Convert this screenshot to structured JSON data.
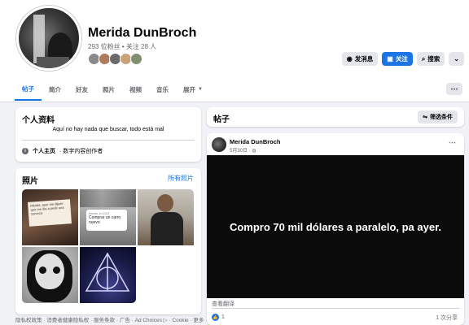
{
  "profile": {
    "name": "Merida DunBroch",
    "followers_line": "293 位粉丝 • 关注 28 人",
    "friend_colors": [
      "#8a8a8a",
      "#b07a5a",
      "#6a6a6a",
      "#c9a27a",
      "#7f8f6f"
    ]
  },
  "header_buttons": {
    "message": "发消息",
    "follow": "关注",
    "search": "搜索"
  },
  "tabs": [
    "帖子",
    "简介",
    "好友",
    "照片",
    "视频",
    "音乐",
    "展开"
  ],
  "intro": {
    "title": "个人资料",
    "empty_text": "Aquí no hay nada que buscar, todo está mal",
    "page_label": "个人主页",
    "page_category": "· 数字内容创作者"
  },
  "photos": {
    "title": "照片",
    "see_all": "所有照片",
    "photo1_note": "Merida, ayer me dijiste que me iba a pedir una cerveza",
    "photo2_small": "Merida, en 2023",
    "photo2_text": "Comprar un carro nuevo"
  },
  "footer": "隐私权政策 · 消费者健康隐私权 · 服务条款 · 广告 · Ad Choices ▷ · Cookie · 更多 ·",
  "posts": {
    "title": "帖子",
    "filter": "筛选条件"
  },
  "post": {
    "author": "Merida DunBroch",
    "date": "5月30日 · ",
    "text": "Compro 70 mil dólares a paralelo, pa ayer.",
    "translate": "查看翻译",
    "reaction_count": "1",
    "shares": "1 次分享"
  },
  "colors": {
    "accent": "#1b74e4",
    "background": "#f0f2f5"
  }
}
